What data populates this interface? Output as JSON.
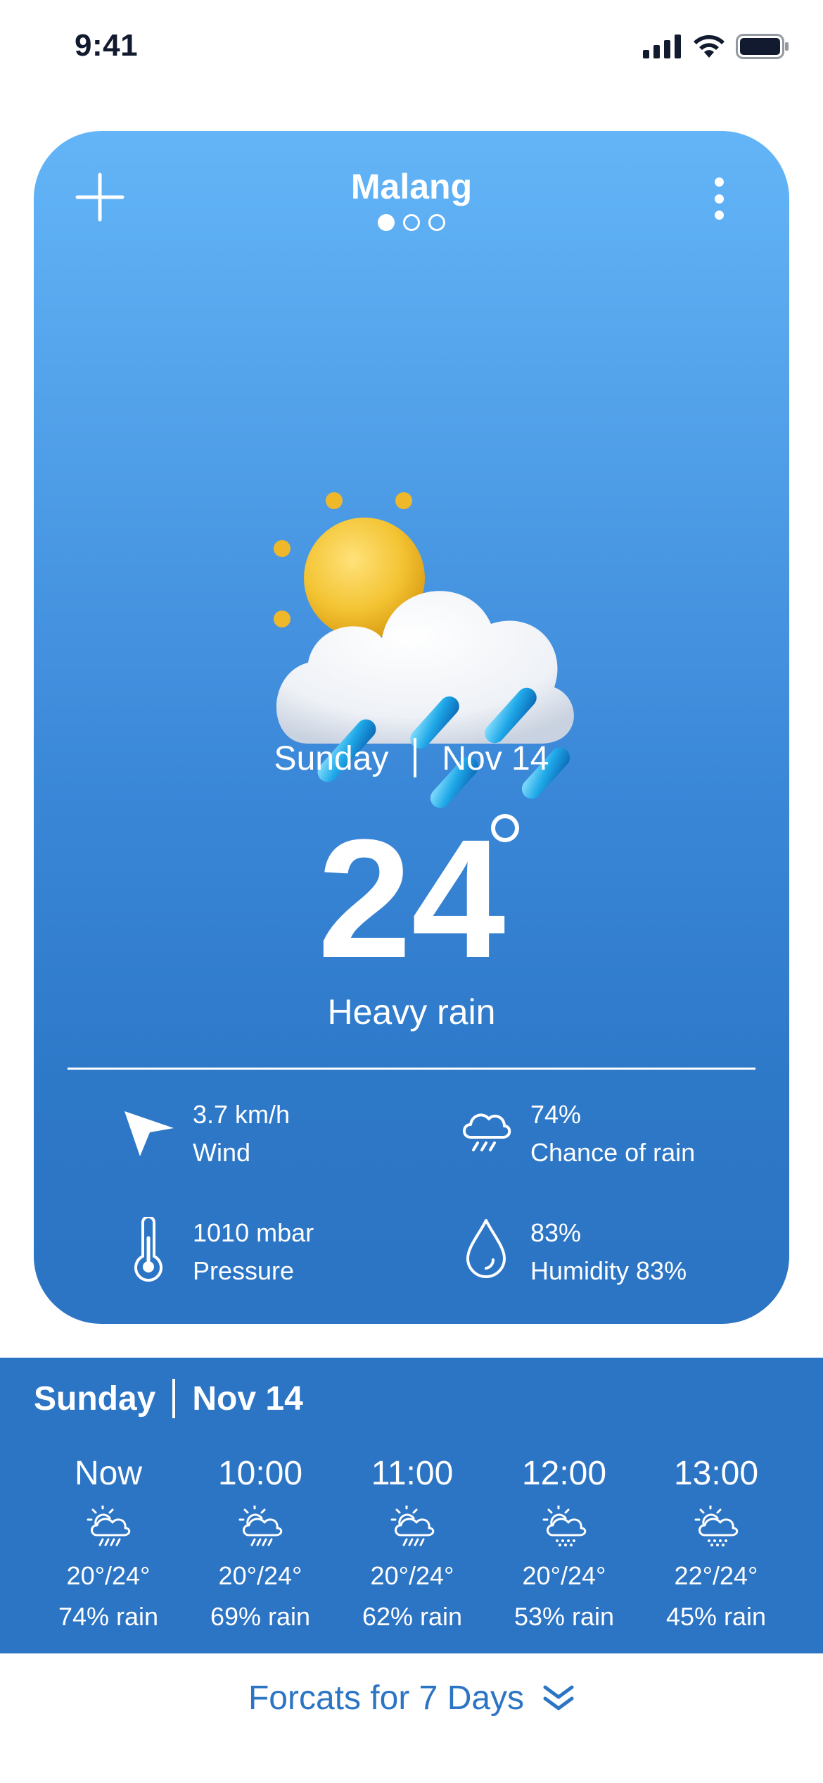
{
  "status_bar": {
    "time": "9:41"
  },
  "header": {
    "city": "Malang",
    "page_count": 3,
    "active_page": 0
  },
  "current": {
    "day": "Sunday",
    "date": "Nov 14",
    "temperature": "24",
    "condition": "Heavy rain",
    "icon": "sun-cloud-heavy-rain-icon"
  },
  "metrics": {
    "wind": {
      "value": "3.7 km/h",
      "label": "Wind",
      "icon": "navigation-arrow-icon"
    },
    "rain": {
      "value": "74%",
      "label": "Chance of rain",
      "icon": "rain-cloud-icon"
    },
    "pressure": {
      "value": "1010 mbar",
      "label": "Pressure",
      "icon": "thermometer-icon"
    },
    "humidity": {
      "value": "83%",
      "label": "Humidity 83%",
      "icon": "water-drop-icon"
    }
  },
  "hourly": {
    "day": "Sunday",
    "date": "Nov 14",
    "items": [
      {
        "time": "Now",
        "temp": "20°/24°",
        "rain": "74% rain",
        "icon": "partly-cloudy-rain-icon"
      },
      {
        "time": "10:00",
        "temp": "20°/24°",
        "rain": "69% rain",
        "icon": "partly-cloudy-rain-icon"
      },
      {
        "time": "11:00",
        "temp": "20°/24°",
        "rain": "62% rain",
        "icon": "partly-cloudy-rain-icon"
      },
      {
        "time": "12:00",
        "temp": "20°/24°",
        "rain": "53% rain",
        "icon": "partly-cloudy-drizzle-icon"
      },
      {
        "time": "13:00",
        "temp": "22°/24°",
        "rain": "45% rain",
        "icon": "partly-cloudy-drizzle-icon"
      }
    ]
  },
  "footer": {
    "forecast_label": "Forcats for 7 Days"
  },
  "colors": {
    "card_top": "#63b5f7",
    "card_bottom": "#2c74c4",
    "accent": "#2c74c4",
    "sun": "#f3c332"
  }
}
